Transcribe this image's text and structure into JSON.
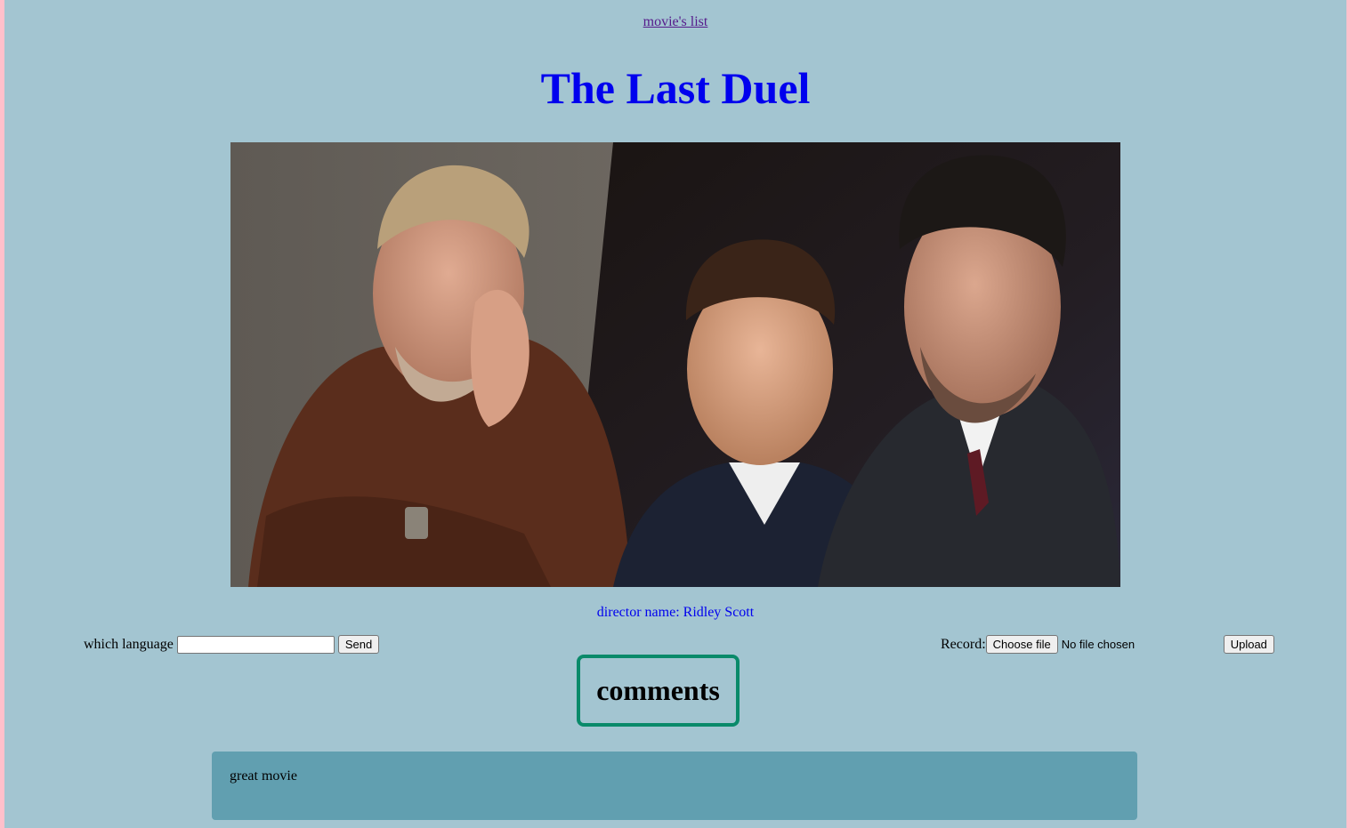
{
  "nav": {
    "movies_link": "movie's list"
  },
  "movie": {
    "title": "The Last Duel",
    "director_text": "director name: Ridley Scott"
  },
  "language_form": {
    "label": "which language",
    "input_value": "",
    "send_label": "Send"
  },
  "record_form": {
    "label": "Record:",
    "choose_file_label": "Choose file",
    "file_status": "No file chosen",
    "upload_label": "Upload"
  },
  "comments": {
    "heading": "comments",
    "items": [
      {
        "text": "great movie"
      }
    ]
  },
  "colors": {
    "page_bg": "#a3c5d1",
    "side_bg": "#ffc0cb",
    "title": "#0000ee",
    "comments_border": "#0a8a6a",
    "comment_card_bg": "#619fb0"
  }
}
